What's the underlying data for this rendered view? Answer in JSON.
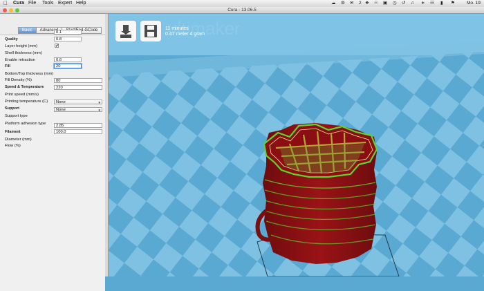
{
  "menubar": {
    "apple_icon": "apple-icon",
    "items": [
      "Cura",
      "File",
      "Tools",
      "Expert",
      "Help"
    ],
    "status": {
      "count": "2",
      "clock": "Mo. 19:"
    }
  },
  "window": {
    "title": "Cura - 13.06.5"
  },
  "tabs": [
    "Basic",
    "Advanced",
    "Start/End-GCode"
  ],
  "quality": {
    "header": "Quality",
    "layer_height": {
      "label": "Layer height (mm)",
      "value": "0.1"
    },
    "shell_thickness": {
      "label": "Shell thickness (mm)",
      "value": "0.8"
    },
    "retraction": {
      "label": "Enable retraction",
      "checked": true,
      "mark": "✔"
    }
  },
  "fill": {
    "header": "Fill",
    "bottom_top": {
      "label": "Bottom/Top thickness (mm)",
      "value": "0.6"
    },
    "density": {
      "label": "Fill Density (%)",
      "value": "20"
    }
  },
  "speed": {
    "header": "Speed & Temperature",
    "print_speed": {
      "label": "Print speed (mm/s)",
      "value": "80"
    },
    "print_temp": {
      "label": "Printing temperature (C)",
      "value": "220"
    }
  },
  "support": {
    "header": "Support",
    "support_type": {
      "label": "Support type",
      "value": "None"
    },
    "adhesion": {
      "label": "Platform adhesion type",
      "value": "None"
    }
  },
  "filament": {
    "header": "Filament",
    "diameter": {
      "label": "Diameter (mm)",
      "value": "2.85"
    },
    "flow": {
      "label": "Flow (%)",
      "value": "100.0"
    }
  },
  "viewport": {
    "load_icon": "load-model-icon",
    "save_icon": "save-floppy-icon",
    "estimate_time": "11 minutes",
    "estimate_material": "0.47 meter 4 gram",
    "watermark": "ultimaker",
    "colors": {
      "background": "#5aa9d3",
      "grid_light": "#82c4e4",
      "model_wall": "#8b0f12",
      "model_outline": "#5dd62c",
      "infill": "#b5a436"
    }
  }
}
